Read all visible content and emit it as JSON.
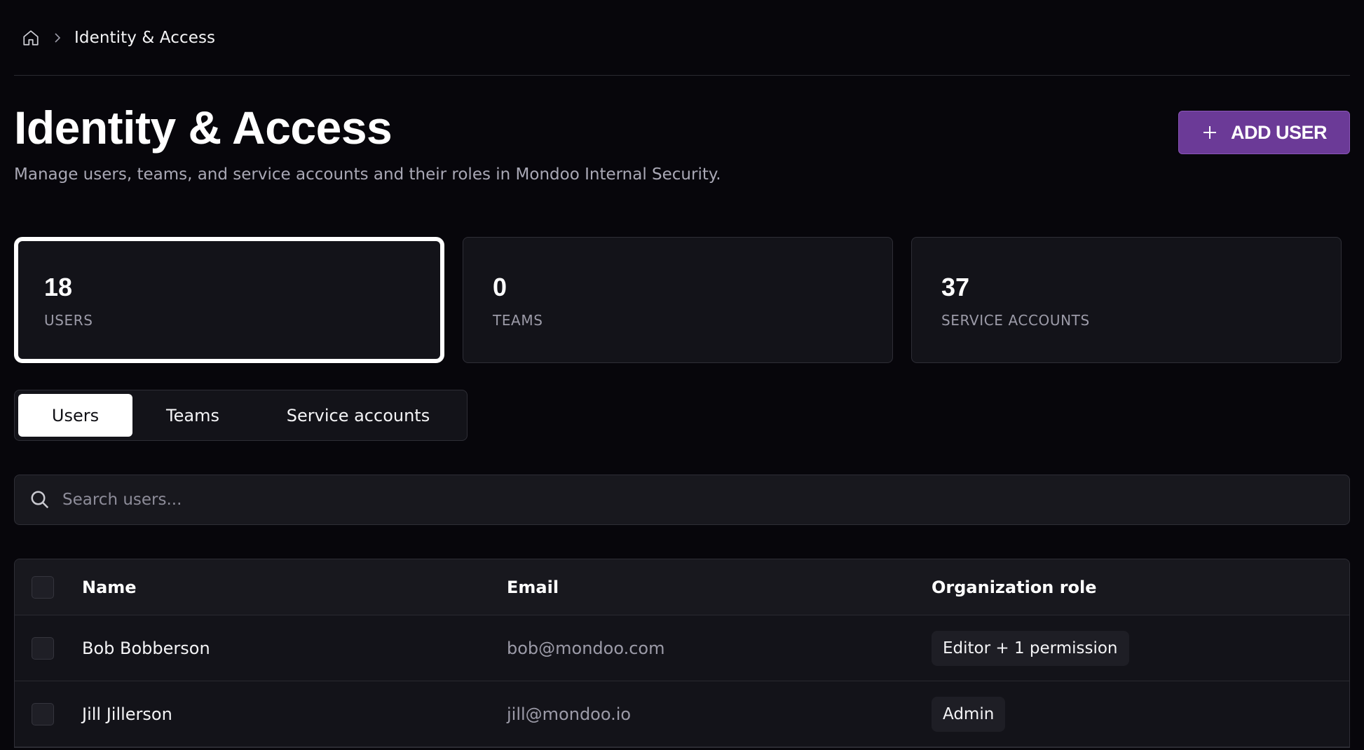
{
  "breadcrumb": {
    "home_icon": "home-icon",
    "separator_icon": "chevron-right-icon",
    "current": "Identity & Access"
  },
  "header": {
    "title": "Identity & Access",
    "subtitle": "Manage users, teams, and service accounts and their roles in Mondoo Internal Security.",
    "add_button_label": "ADD USER",
    "add_button_icon": "plus-icon"
  },
  "stats": [
    {
      "value": "18",
      "label": "USERS",
      "active": true
    },
    {
      "value": "0",
      "label": "TEAMS",
      "active": false
    },
    {
      "value": "37",
      "label": "SERVICE ACCOUNTS",
      "active": false
    }
  ],
  "tabs": [
    {
      "label": "Users",
      "selected": true
    },
    {
      "label": "Teams",
      "selected": false
    },
    {
      "label": "Service accounts",
      "selected": false
    }
  ],
  "search": {
    "icon": "search-icon",
    "placeholder": "Search users...",
    "value": ""
  },
  "table": {
    "columns": [
      "Name",
      "Email",
      "Organization role"
    ],
    "rows": [
      {
        "name": "Bob Bobberson",
        "email": "bob@mondoo.com",
        "role": "Editor + 1 permission"
      },
      {
        "name": "Jill Jillerson",
        "email": "jill@mondoo.io",
        "role": "Admin"
      }
    ]
  },
  "colors": {
    "background": "#07060b",
    "accent": "#6b3a97",
    "card": "#131319",
    "muted_text": "#9c9ba8"
  }
}
